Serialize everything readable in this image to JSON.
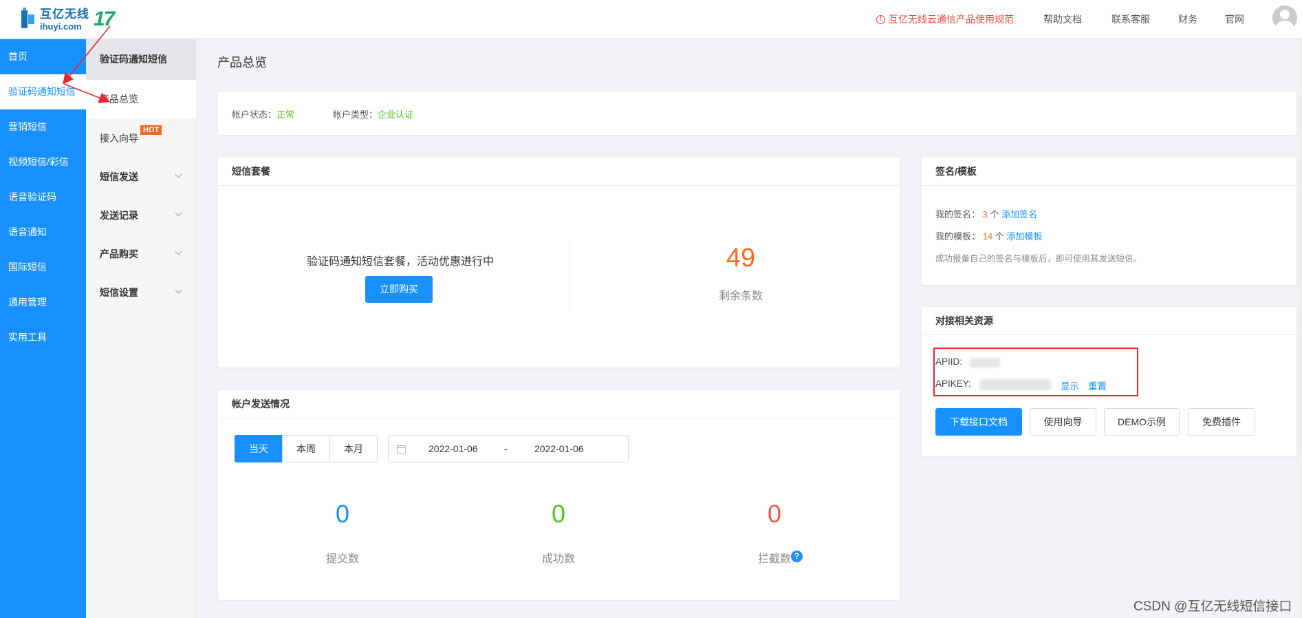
{
  "topbar": {
    "logo_cn": "互亿无线",
    "logo_en": "ihuyi.com",
    "logo_badge": "17",
    "notice": "互亿无线云通信产品使用规范",
    "links": [
      "帮助文档",
      "联系客服",
      "财务",
      "官网"
    ]
  },
  "sidebar": {
    "items": [
      "首页",
      "验证码通知短信",
      "营销短信",
      "视频短信/彩信",
      "语音验证码",
      "语音通知",
      "国际短信",
      "通用管理",
      "实用工具"
    ],
    "active_index": 1
  },
  "subnav": {
    "title": "验证码通知短信",
    "items": [
      "产品总览",
      "接入向导",
      "短信发送",
      "发送记录",
      "产品购买",
      "短信设置"
    ],
    "hot_badge": "HOT"
  },
  "page": {
    "title": "产品总览"
  },
  "account": {
    "status_label": "帐户状态：",
    "status_value": "正常",
    "type_label": "帐户类型：",
    "type_value": "企业认证"
  },
  "package": {
    "title": "短信套餐",
    "promo": "验证码通知短信套餐，活动优惠进行中",
    "buy_button": "立即购买",
    "remaining": "49",
    "remaining_label": "剩余条数"
  },
  "sending": {
    "title": "帐户发送情况",
    "ranges": [
      "当天",
      "本周",
      "本月"
    ],
    "active_range": "当天",
    "date_from": "2022-01-06",
    "date_sep": "-",
    "date_to": "2022-01-06",
    "stats": [
      {
        "value": "0",
        "label": "提交数"
      },
      {
        "value": "0",
        "label": "成功数"
      },
      {
        "value": "0",
        "label": "拦截数"
      }
    ],
    "help_icon_text": "?"
  },
  "signature": {
    "title": "签名/模板",
    "sig_label": "我的签名：",
    "sig_count": "3",
    "sig_unit": "个",
    "sig_add": "添加签名",
    "tpl_label": "我的模板：",
    "tpl_count": "14",
    "tpl_unit": "个",
    "tpl_add": "添加模板",
    "note": "成功报备自己的签名与模板后，即可使用其发送短信。"
  },
  "resources": {
    "title": "对接相关资源",
    "apiid_label": "APIID:",
    "apikey_label": "APIKEY:",
    "show": "显示",
    "reset": "重置",
    "buttons": [
      "下载接口文档",
      "使用向导",
      "DEMO示例",
      "免费插件"
    ]
  },
  "watermark": "CSDN @互亿无线短信接口",
  "colors": {
    "primary": "#1890ff",
    "green": "#52c41a",
    "orange": "#fa6b1f",
    "red": "#f5483b",
    "annotation_red": "#e8262c"
  },
  "icons": [
    "warning-icon",
    "user-avatar-icon",
    "chevron-down-icon",
    "calendar-icon",
    "help-icon",
    "annotation-arrow"
  ]
}
